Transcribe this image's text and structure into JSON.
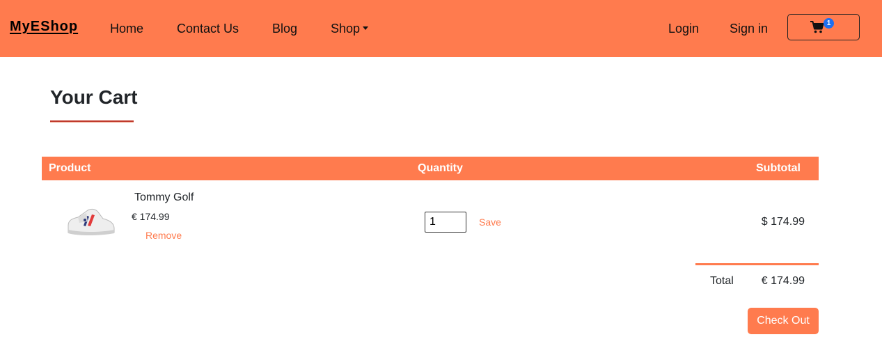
{
  "colors": {
    "accent": "#ff7b4e",
    "badge": "#1e6ff0",
    "title_underline": "#c0392b"
  },
  "navbar": {
    "brand": "MyEShop",
    "links": [
      "Home",
      "Contact Us",
      "Blog",
      "Shop"
    ],
    "login": "Login",
    "signin": "Sign in",
    "cart_icon": "shopping-cart-icon",
    "cart_count": "1"
  },
  "page": {
    "title": "Your Cart"
  },
  "table": {
    "headers": {
      "product": "Product",
      "quantity": "Quantity",
      "subtotal": "Subtotal"
    },
    "rows": [
      {
        "image": "sneaker-image",
        "name": "Tommy Golf",
        "price": "€ 174.99",
        "remove_label": "Remove",
        "quantity": "1",
        "save_label": "Save",
        "subtotal": "$ 174.99"
      }
    ]
  },
  "summary": {
    "total_label": "Total",
    "total_value": "€ 174.99"
  },
  "checkout_label": "Check Out"
}
